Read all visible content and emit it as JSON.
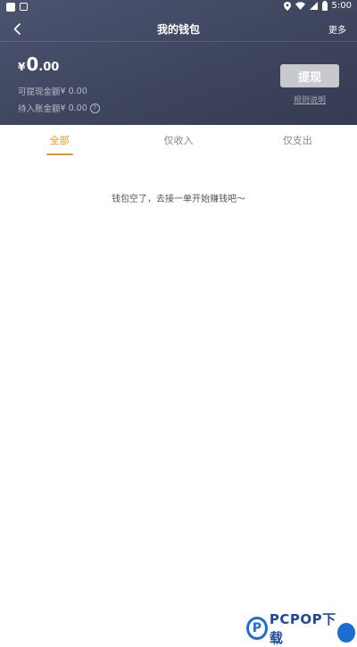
{
  "status_bar": {
    "time": "5:00"
  },
  "nav": {
    "title": "我的钱包",
    "more_label": "更多"
  },
  "wallet": {
    "currency": "¥",
    "balance_int": "0",
    "balance_dec": ".00",
    "withdrawable_label": "可提现金额",
    "withdrawable_value": "¥ 0.00",
    "pending_label": "待入账金额",
    "pending_value": "¥ 0.00",
    "withdraw_label": "提现",
    "rules_label": "规则说明"
  },
  "tabs": [
    {
      "label": "全部",
      "active": true
    },
    {
      "label": "仅收入",
      "active": false
    },
    {
      "label": "仅支出",
      "active": false
    }
  ],
  "empty_message": "钱包空了，去接一单开始赚钱吧～",
  "watermark": {
    "logo_letter": "P",
    "text": "PCPOP下载"
  },
  "colors": {
    "header_bg": "#3e455e",
    "accent": "#e8961e",
    "withdraw_button": "#c7c9cf"
  }
}
